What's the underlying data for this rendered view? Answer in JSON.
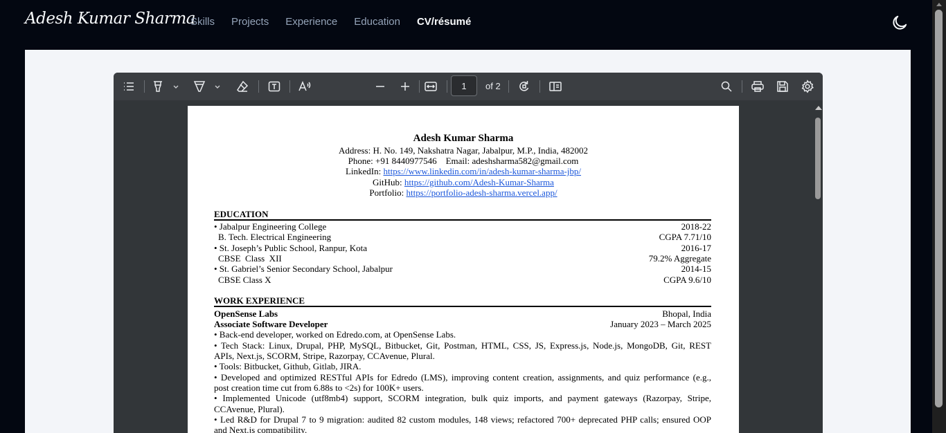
{
  "nav": {
    "logo": "Adesh Kumar Sharma",
    "links": [
      "Skills",
      "Projects",
      "Experience",
      "Education",
      "CV/résumé"
    ],
    "theme_icon": "moon-icon"
  },
  "pdf_toolbar": {
    "page_current": "1",
    "page_total_label": "of 2",
    "icons": [
      "sidebar-list-icon",
      "highlight-icon",
      "chevron-down-icon",
      "draw-icon",
      "chevron-down-icon",
      "eraser-icon",
      "text-box-icon",
      "read-aloud-icon",
      "zoom-out-icon",
      "zoom-in-icon",
      "fit-page-icon",
      "rotate-icon",
      "page-view-icon",
      "search-icon",
      "print-icon",
      "save-icon",
      "settings-icon"
    ]
  },
  "resume": {
    "name": "Adesh Kumar Sharma",
    "address": "Address: H. No. 149, Nakshatra Nagar, Jabalpur, M.P., India, 482002",
    "phone_email": "Phone: +91 8440977546    Email: adeshsharma582@gmail.com",
    "linkedin_label": "LinkedIn: ",
    "linkedin_url": "https://www.linkedin.com/in/adesh-kumar-sharma-jbp/",
    "github_label": "GitHub: ",
    "github_url": "https://github.com/Adesh-Kumar-Sharma",
    "portfolio_label": "Portfolio: ",
    "portfolio_url": "https://portfolio-adesh-sharma.vercel.app/",
    "education_heading": "EDUCATION",
    "education": [
      {
        "left": "• Jabalpur Engineering College",
        "right": "2018-22"
      },
      {
        "left": "B. Tech. Electrical Engineering",
        "right": "CGPA 7.71/10"
      },
      {
        "left": "• St. Joseph’s Public School, Ranpur, Kota",
        "right": "2016-17"
      },
      {
        "left": "CBSE  Class  XII",
        "right": "79.2% Aggregate"
      },
      {
        "left": "• St. Gabriel’s Senior Secondary School, Jabalpur",
        "right": "2014-15"
      },
      {
        "left": "CBSE Class X",
        "right": "CGPA 9.6/10"
      }
    ],
    "work_heading": "WORK EXPERIENCE",
    "company": "OpenSense Labs",
    "location": "Bhopal, India",
    "role": "Associate Software Developer",
    "dates": "January 2023 – March 2025",
    "bullets": [
      "• Back-end developer, worked on Edredo.com, at OpenSense Labs.",
      "• Tech Stack: Linux, Drupal, PHP, MySQL, Bitbucket, Git, Postman, HTML, CSS, JS, Express.js, Node.js, MongoDB, Git, REST",
      "APIs, Next.js, SCORM, Stripe, Razorpay, CCAvenue, Plural.",
      "• Tools: Bitbucket, Github, Gitlab, JIRA.",
      "• Developed and optimized RESTful APIs for Edredo (LMS), improving content creation, assignments, and quiz performance (e.g.,",
      "post creation time cut from 6.88s to <2s) for 100K+ users.",
      "• Implemented Unicode (utf8mb4) support, SCORM integration, bulk quiz imports, and payment gateways (Razorpay, Stripe,",
      "CCAvenue, Plural).",
      "• Led R&D for Drupal 7 to 9 migration: audited 82 custom modules, 148 views; refactored 700+ deprecated PHP calls; ensured OOP",
      "and Next.js compatibility."
    ]
  }
}
